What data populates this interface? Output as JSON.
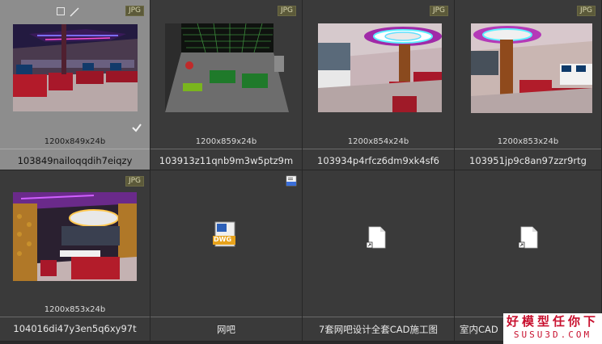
{
  "tiles": [
    {
      "dims": "1200x849x24b",
      "name": "103849nailoqqdih7eiqzy",
      "type": "JPG",
      "selected": true
    },
    {
      "dims": "1200x859x24b",
      "name": "103913z11qnb9m3w5ptz9m",
      "type": "JPG"
    },
    {
      "dims": "1200x854x24b",
      "name": "103934p4rfcz6dm9xk4sf6",
      "type": "JPG"
    },
    {
      "dims": "1200x853x24b",
      "name": "103951jp9c8an97zzr9rtg",
      "type": "JPG"
    },
    {
      "dims": "1200x853x24b",
      "name": "104016di47y3en5q6xy97t",
      "type": "JPG"
    },
    {
      "name": "网吧",
      "folder_icon": "folder-shortcut-icon",
      "file_icon": "dwg-file-icon",
      "file_label": "DWG"
    },
    {
      "name": "7套网吧设计全套CAD施工图",
      "file_icon": "blank-file-shortcut-icon"
    },
    {
      "name": "室内CAD",
      "file_icon": "blank-file-shortcut-icon"
    }
  ],
  "watermark": {
    "line1": "好模型任你下",
    "line2": "SUSU3D.COM"
  },
  "colors": {
    "tile_bg": "#3a3a3a",
    "selected_bg": "#8d8d8d",
    "badge_bg": "#5c5a3a",
    "watermark_red": "#c8102e"
  }
}
